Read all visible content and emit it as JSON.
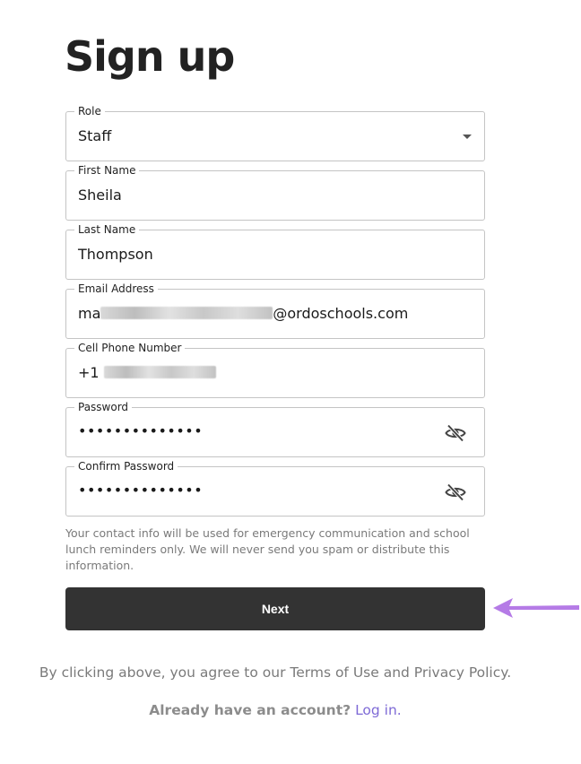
{
  "page": {
    "title": "Sign up"
  },
  "form": {
    "role": {
      "label": "Role",
      "value": "Staff"
    },
    "first_name": {
      "label": "First Name",
      "value": "Sheila"
    },
    "last_name": {
      "label": "Last Name",
      "value": "Thompson"
    },
    "email": {
      "label": "Email Address",
      "prefix": "ma",
      "suffix": "@ordoschools.com"
    },
    "phone": {
      "label": "Cell Phone Number",
      "prefix": "+1"
    },
    "password": {
      "label": "Password",
      "value": "••••••••••••••"
    },
    "confirm_password": {
      "label": "Confirm Password",
      "value": "••••••••••••••"
    }
  },
  "info_text": "Your contact info will be used for emergency communication and school lunch reminders only. We will never send you spam or distribute this information.",
  "next_button": {
    "label": "Next"
  },
  "terms_text": "By clicking above, you agree to our Terms of Use and Privacy Policy.",
  "login": {
    "question": "Already have an account?",
    "link": "Log in."
  },
  "icons": {
    "select": "chevron-down-icon",
    "visibility": "eye-off-icon",
    "annotation": "arrow-left-icon"
  },
  "colors": {
    "button_bg": "#333333",
    "link": "#7e6ad6",
    "annotation_arrow": "#b57be6"
  }
}
